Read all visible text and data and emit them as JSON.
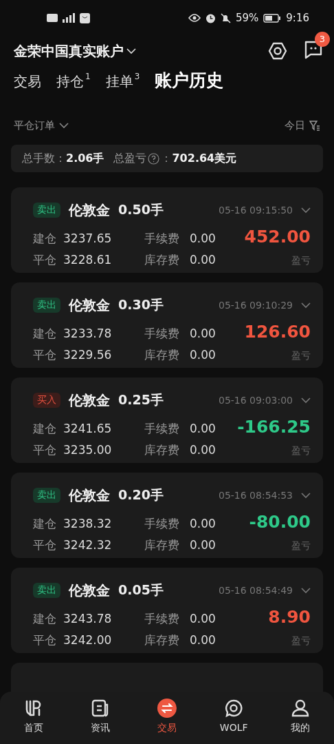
{
  "status_bar": {
    "battery": "59%",
    "time": "9:16"
  },
  "header": {
    "account": "金荣中国真实账户",
    "message_count": "3"
  },
  "tabs": [
    {
      "label": "交易",
      "selected": false
    },
    {
      "label": "持仓",
      "count": "1",
      "selected": false
    },
    {
      "label": "挂单",
      "count": "3",
      "selected": false
    },
    {
      "label": "账户历史",
      "selected": true
    }
  ],
  "filter": {
    "order_type": "平仓订单",
    "period": "今日"
  },
  "summary": {
    "lots_label": "总手数：",
    "lots": "2.06手",
    "pnl_label": "总盈亏",
    "pnl_colon": "：",
    "pnl": "702.64美元"
  },
  "orders": [
    {
      "kind": "sell",
      "side": "卖出",
      "symbol": "伦敦金",
      "lots": "0.50手",
      "time": "05-16 09:15:50",
      "open_label": "建仓",
      "open": "3237.65",
      "fee_label": "手续费",
      "fee": "0.00",
      "close_label": "平仓",
      "close": "3228.61",
      "swap_label": "库存费",
      "swap": "0.00",
      "pnl": "452.00",
      "color": "#f0553f",
      "pnl_label": "盈亏"
    },
    {
      "kind": "sell",
      "side": "卖出",
      "symbol": "伦敦金",
      "lots": "0.30手",
      "time": "05-16 09:10:29",
      "open_label": "建仓",
      "open": "3233.78",
      "fee_label": "手续费",
      "fee": "0.00",
      "close_label": "平仓",
      "close": "3229.56",
      "swap_label": "库存费",
      "swap": "0.00",
      "pnl": "126.60",
      "color": "#f0553f",
      "pnl_label": "盈亏"
    },
    {
      "kind": "buy",
      "side": "买入",
      "symbol": "伦敦金",
      "lots": "0.25手",
      "time": "05-16 09:03:00",
      "open_label": "建仓",
      "open": "3241.65",
      "fee_label": "手续费",
      "fee": "0.00",
      "close_label": "平仓",
      "close": "3235.00",
      "swap_label": "库存费",
      "swap": "0.00",
      "pnl": "-166.25",
      "color": "#2ec989",
      "pnl_label": "盈亏"
    },
    {
      "kind": "sell",
      "side": "卖出",
      "symbol": "伦敦金",
      "lots": "0.20手",
      "time": "05-16 08:54:53",
      "open_label": "建仓",
      "open": "3238.32",
      "fee_label": "手续费",
      "fee": "0.00",
      "close_label": "平仓",
      "close": "3242.32",
      "swap_label": "库存费",
      "swap": "0.00",
      "pnl": "-80.00",
      "color": "#2ec989",
      "pnl_label": "盈亏"
    },
    {
      "kind": "sell",
      "side": "卖出",
      "symbol": "伦敦金",
      "lots": "0.05手",
      "time": "05-16 08:54:49",
      "open_label": "建仓",
      "open": "3243.78",
      "fee_label": "手续费",
      "fee": "0.00",
      "close_label": "平仓",
      "close": "3242.00",
      "swap_label": "库存费",
      "swap": "0.00",
      "pnl": "8.90",
      "color": "#f0553f",
      "pnl_label": "盈亏"
    }
  ],
  "nav": [
    {
      "label": "首页",
      "selected": false
    },
    {
      "label": "资讯",
      "selected": false
    },
    {
      "label": "交易",
      "selected": true
    },
    {
      "label": "WOLF",
      "selected": false
    },
    {
      "label": "我的",
      "selected": false
    }
  ]
}
